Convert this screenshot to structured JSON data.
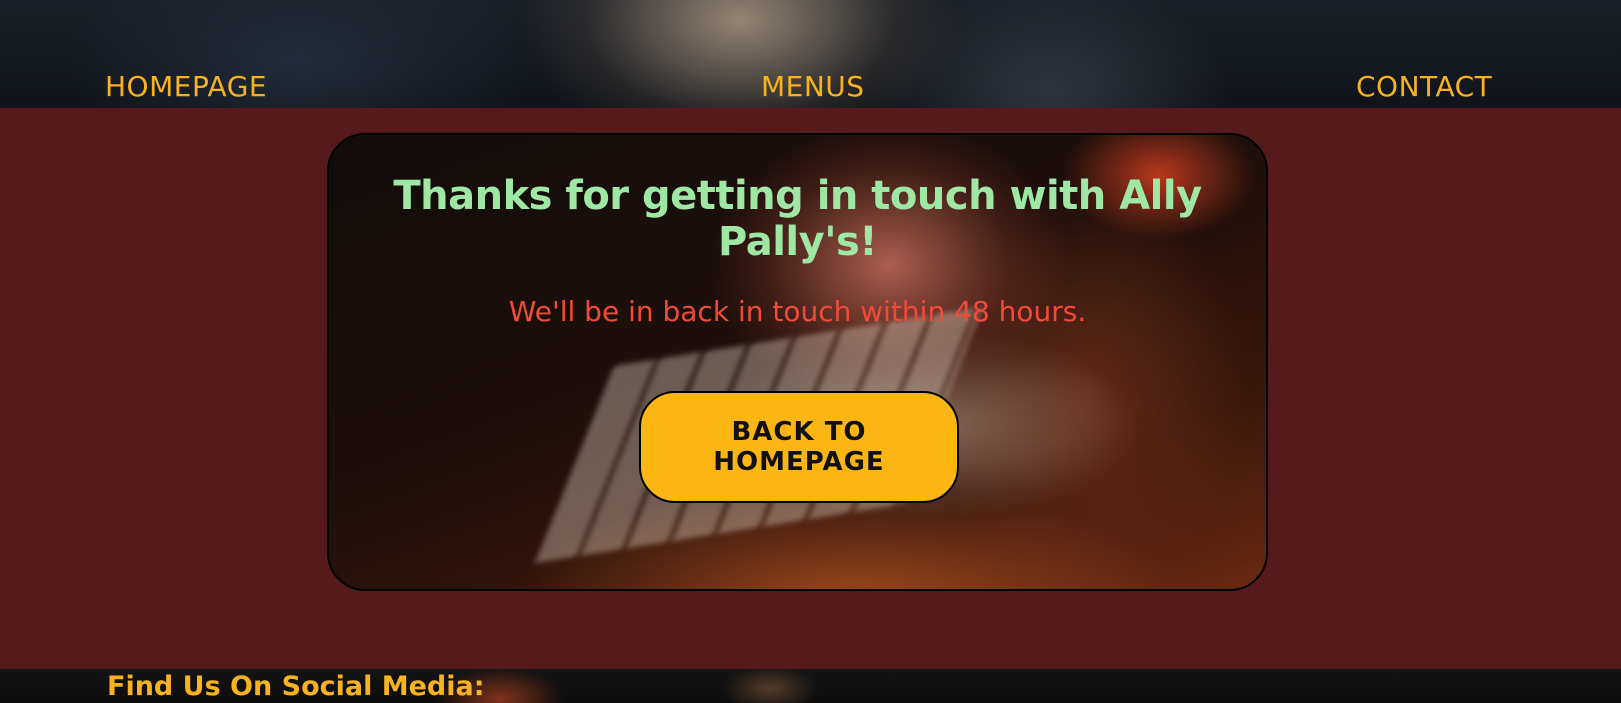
{
  "nav": {
    "home_label": "HOMEPAGE",
    "menus_label": "MENUS",
    "contact_label": "CONTACT"
  },
  "card": {
    "title": "Thanks for getting in touch with Ally Pally's!",
    "subtitle": "We'll be in back in touch within 48 hours.",
    "button_label": "BACK TO HOMEPAGE"
  },
  "footer": {
    "heading": "Find Us On Social Media:"
  },
  "colors": {
    "accent": "#f7b220",
    "page_background": "#571a1c",
    "title_green": "#9ee8a3",
    "subtitle_red": "#f14a35",
    "button_yellow": "#fbb614"
  }
}
